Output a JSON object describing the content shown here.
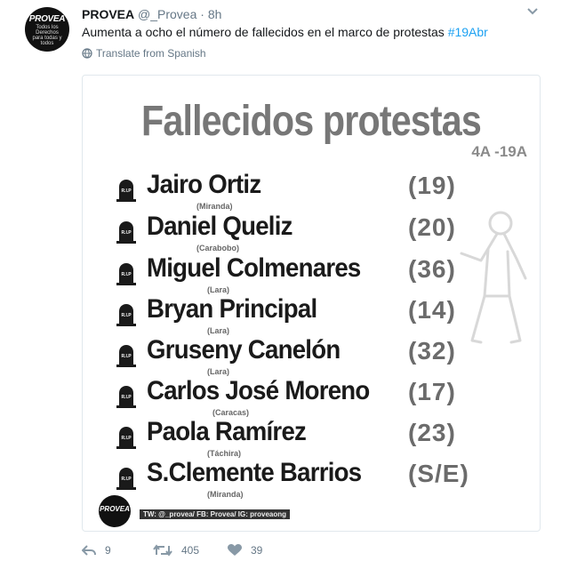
{
  "tweet": {
    "display_name": "PROVEA",
    "handle": "@_Provea",
    "separator": "·",
    "time": "8h",
    "text": "Aumenta a ocho el número de fallecidos en el marco de protestas ",
    "hashtag": "#19Abr",
    "translate_label": "Translate from Spanish",
    "avatar": {
      "title": "PROVEA",
      "subtitle": "Todos los Derechos para todas y todos"
    }
  },
  "image_card": {
    "title": "Fallecidos protestas",
    "subtitle": "4A -19A",
    "victims": [
      {
        "name": "Jairo Ortiz",
        "state": "(Miranda)",
        "age": "(19)"
      },
      {
        "name": "Daniel Queliz",
        "state": "(Carabobo)",
        "age": "(20)"
      },
      {
        "name": "Miguel Colmenares",
        "state": "(Lara)",
        "age": "(36)"
      },
      {
        "name": "Bryan Principal",
        "state": "(Lara)",
        "age": "(14)"
      },
      {
        "name": "Gruseny Canelón",
        "state": "(Lara)",
        "age": "(32)"
      },
      {
        "name": "Carlos José Moreno",
        "state": "(Caracas)",
        "age": "(17)"
      },
      {
        "name": "Paola Ramírez",
        "state": "(Táchira)",
        "age": "(23)"
      },
      {
        "name": "S.Clemente Barrios",
        "state": "(Miranda)",
        "age": "(S/E)"
      }
    ],
    "tombstone_text": "R.I.P",
    "footer_logo": "PROVEA",
    "footer_social": "TW: @_provea/ FB: Provea/ IG: proveaong"
  },
  "actions": {
    "reply_count": "9",
    "retweet_count": "405",
    "like_count": "39"
  },
  "colors": {
    "text": "#14171a",
    "muted": "#657786",
    "link": "#1da1f2",
    "border": "#e1e8ed"
  },
  "icons": [
    "chevron-down-icon",
    "globe-icon",
    "tombstone-icon",
    "reply-icon",
    "retweet-icon",
    "heart-icon"
  ]
}
